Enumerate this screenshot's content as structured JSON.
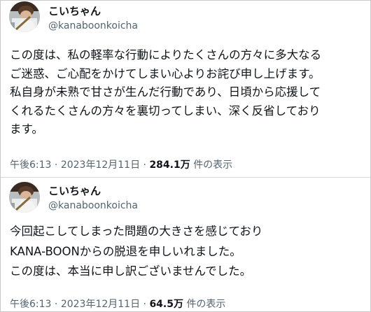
{
  "tweets": [
    {
      "display_name": "こいちゃん",
      "handle": "@kanaboonkoicha",
      "avatar_icon": "profile-photo-icon",
      "body_lines": [
        "この度は、私の軽率な行動によりたくさんの方々に多大なる",
        "ご迷惑、ご心配をかけてしまい心よりお詫び申し上げます。",
        "私自身が未熟で甘さが生んだ行動であり、日頃から応援して",
        "くれるたくさんの方々を裏切ってしまい、深く反省しており",
        "ます。"
      ],
      "time": "午後6:13",
      "separator": "·",
      "date": "2023年12月11日",
      "views_count": "284.1万",
      "views_label": "件の表示"
    },
    {
      "display_name": "こいちゃん",
      "handle": "@kanaboonkoicha",
      "avatar_icon": "profile-photo-icon",
      "body_lines": [
        "今回起こしてしまった問題の大きさを感じており",
        "KANA-BOONからの脱退を申しいれました。",
        "この度は、本当に申し訳ございませんでした。"
      ],
      "time": "午後6:13",
      "separator": "·",
      "date": "2023年12月11日",
      "views_count": "64.5万",
      "views_label": "件の表示"
    }
  ],
  "colors": {
    "text_primary": "#0f1419",
    "text_secondary": "#536471",
    "border": "#c9c9c9",
    "background": "#ffffff"
  }
}
